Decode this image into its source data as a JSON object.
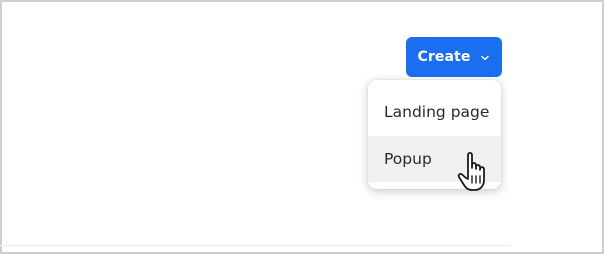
{
  "create_button": {
    "label": "Create",
    "icon": "chevron-down-icon"
  },
  "dropdown": {
    "items": [
      {
        "label": "Landing page"
      },
      {
        "label": "Popup"
      }
    ],
    "hovered_item": "Popup"
  },
  "cursor": {
    "icon": "hand-pointer-icon"
  },
  "colors": {
    "accent": "#1a6ff0",
    "menu_hover": "#f0f0f0",
    "frame_border": "#cfcfcf"
  }
}
